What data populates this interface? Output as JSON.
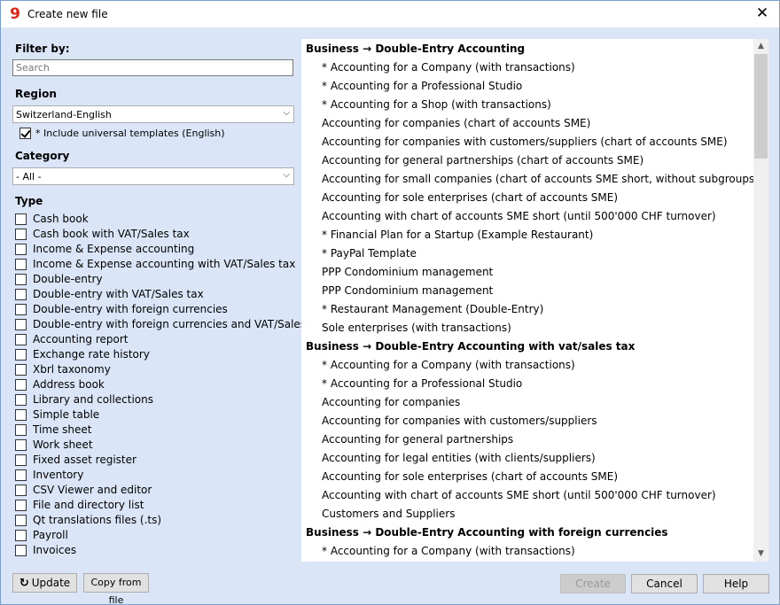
{
  "window": {
    "title": "Create new file",
    "close_glyph": "✕",
    "app_icon_glyph": "9"
  },
  "filter": {
    "label": "Filter by:",
    "search_placeholder": "Search"
  },
  "region": {
    "label": "Region",
    "selected": "Switzerland-English",
    "include_universal": {
      "label": "* Include universal templates (English)",
      "checked": true
    }
  },
  "category": {
    "label": "Category",
    "selected": "- All -"
  },
  "type": {
    "label": "Type",
    "items": [
      "Cash book",
      "Cash book with VAT/Sales tax",
      "Income & Expense accounting",
      "Income & Expense accounting with VAT/Sales tax",
      "Double-entry",
      "Double-entry with VAT/Sales tax",
      "Double-entry with foreign currencies",
      "Double-entry with foreign currencies and VAT/Sales tax",
      "Accounting report",
      "Exchange rate history",
      "Xbrl taxonomy",
      "Address book",
      "Library and collections",
      "Simple table",
      "Time sheet",
      "Work sheet",
      "Fixed asset register",
      "Inventory",
      "CSV Viewer and editor",
      "File and directory list",
      "Qt translations files (.ts)",
      "Payroll",
      "Invoices"
    ]
  },
  "templates": [
    {
      "kind": "header",
      "text": "Business → Double-Entry Accounting"
    },
    {
      "kind": "item",
      "text": "* Accounting for a Company (with transactions)"
    },
    {
      "kind": "item",
      "text": "* Accounting for a Professional Studio"
    },
    {
      "kind": "item",
      "text": "* Accounting for a Shop (with transactions)"
    },
    {
      "kind": "item",
      "text": "Accounting for companies (chart of accounts SME)"
    },
    {
      "kind": "item",
      "text": "Accounting for companies with customers/suppliers (chart of accounts SME)"
    },
    {
      "kind": "item",
      "text": "Accounting for general partnerships (chart of accounts SME)"
    },
    {
      "kind": "item",
      "text": "Accounting for small companies (chart of accounts SME short, without subgroups)"
    },
    {
      "kind": "item",
      "text": "Accounting for sole enterprises (chart of accounts SME)"
    },
    {
      "kind": "item",
      "text": "Accounting with chart of accounts SME short (until 500'000 CHF turnover)"
    },
    {
      "kind": "item",
      "text": "* Financial Plan for a Startup (Example Restaurant)"
    },
    {
      "kind": "item",
      "text": "* PayPal Template"
    },
    {
      "kind": "item",
      "text": "PPP Condominium management"
    },
    {
      "kind": "item",
      "text": "PPP Condominium management"
    },
    {
      "kind": "item",
      "text": "* Restaurant Management (Double-Entry)"
    },
    {
      "kind": "item",
      "text": "Sole enterprises (with transactions)"
    },
    {
      "kind": "header",
      "text": "Business → Double-Entry Accounting with vat/sales tax"
    },
    {
      "kind": "item",
      "text": "* Accounting for a Company (with transactions)"
    },
    {
      "kind": "item",
      "text": "* Accounting for a Professional Studio"
    },
    {
      "kind": "item",
      "text": "Accounting for companies"
    },
    {
      "kind": "item",
      "text": "Accounting for companies with customers/suppliers"
    },
    {
      "kind": "item",
      "text": "Accounting for general partnerships"
    },
    {
      "kind": "item",
      "text": "Accounting for legal entities (with clients/suppliers)"
    },
    {
      "kind": "item",
      "text": "Accounting for sole enterprises (chart of accounts SME)"
    },
    {
      "kind": "item",
      "text": "Accounting with chart of accounts SME short (until 500'000 CHF turnover)"
    },
    {
      "kind": "item",
      "text": "Customers and Suppliers"
    },
    {
      "kind": "header",
      "text": "Business → Double-Entry Accounting with foreign currencies"
    },
    {
      "kind": "item",
      "text": "* Accounting for a Company (with transactions)"
    }
  ],
  "buttons": {
    "update": "Update",
    "copy_from_file": "Copy from file",
    "create": "Create",
    "cancel": "Cancel",
    "help": "Help"
  },
  "icons": {
    "refresh": "↻",
    "dropdown": "⌵",
    "scroll_up": "▲",
    "scroll_down": "▼"
  }
}
